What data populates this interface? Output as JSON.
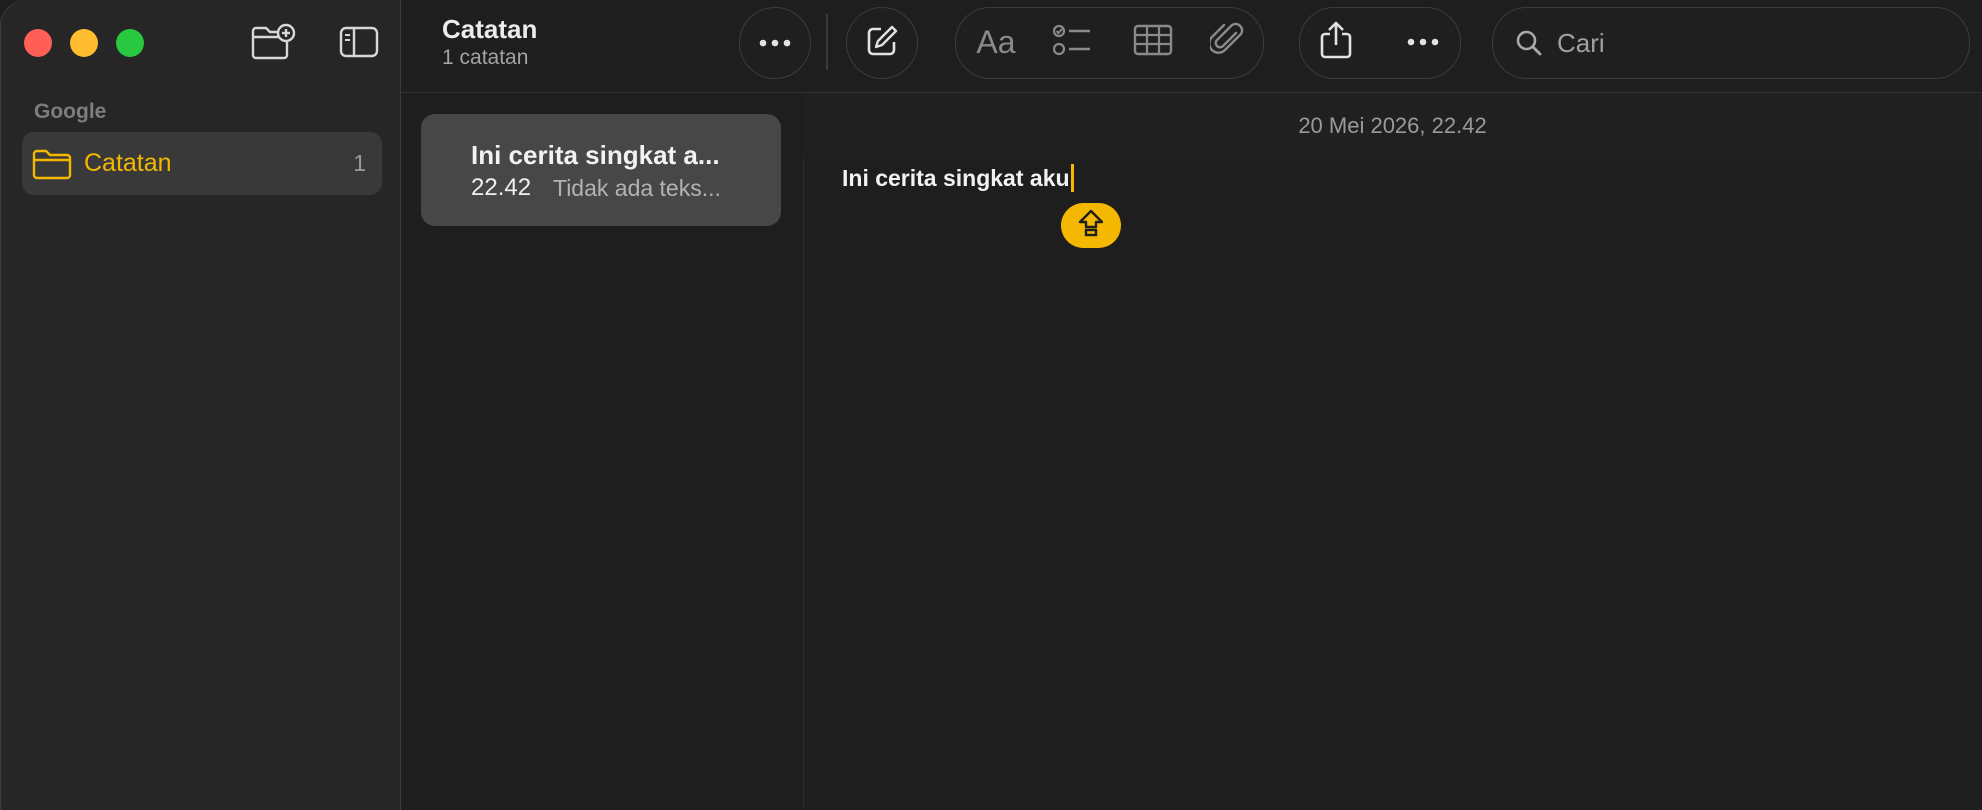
{
  "sidebar": {
    "section_label": "Google",
    "items": [
      {
        "label": "Catatan",
        "count": "1",
        "icon": "folder-icon"
      }
    ]
  },
  "toolbar": {
    "title": "Catatan",
    "subtitle": "1 catatan",
    "icons": [
      "new-folder-icon",
      "sidebar-toggle-icon",
      "more-icon",
      "compose-icon",
      "format-text-icon",
      "checklist-icon",
      "table-icon",
      "attachment-icon",
      "share-icon",
      "more-options-icon",
      "search-icon"
    ],
    "format_label": "Aa"
  },
  "search": {
    "placeholder": "Cari"
  },
  "note_list": {
    "notes": [
      {
        "title": "Ini cerita singkat a...",
        "time": "22.42",
        "preview": "Tidak ada teks..."
      }
    ]
  },
  "editor": {
    "date": "20 Mei 2026, 22.42",
    "content": "Ini cerita singkat aku"
  },
  "colors": {
    "accent": "#f5b800",
    "background": "#1e1e1e",
    "sidebar": "#262626",
    "selected_note": "#474747",
    "close": "#ff5f57",
    "minimize": "#febc2e",
    "zoom": "#28c840"
  }
}
